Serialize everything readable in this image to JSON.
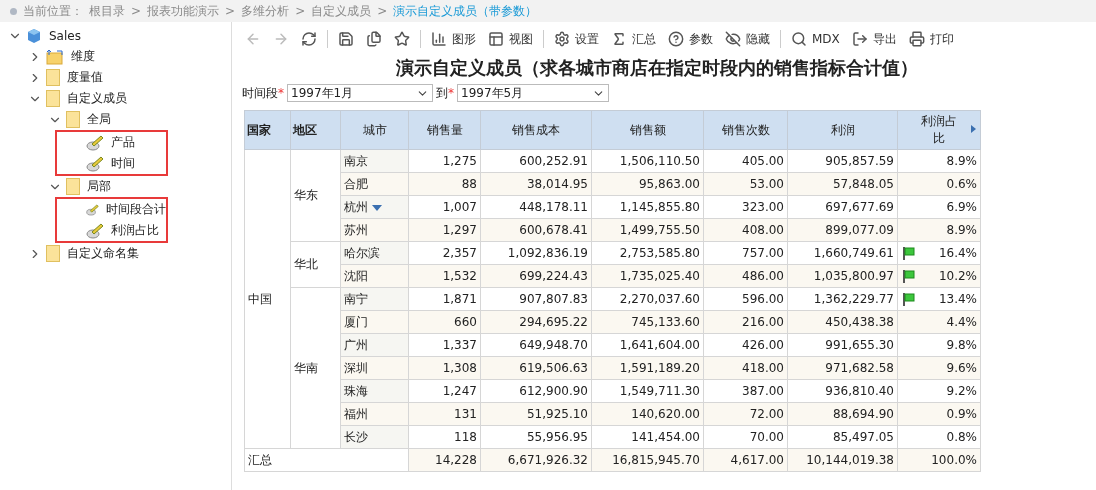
{
  "breadcrumb": {
    "label": "当前位置：",
    "items": [
      {
        "kind": "link",
        "text": "根目录",
        "selected": false
      },
      {
        "kind": "sep",
        "text": ">"
      },
      {
        "kind": "link",
        "text": "报表功能演示",
        "selected": false
      },
      {
        "kind": "sep",
        "text": ">"
      },
      {
        "kind": "link",
        "text": "多维分析",
        "selected": false
      },
      {
        "kind": "sep",
        "text": ">"
      },
      {
        "kind": "link",
        "text": "自定义成员",
        "selected": false
      },
      {
        "kind": "sep",
        "text": ">"
      },
      {
        "kind": "link",
        "text": "演示自定义成员（带参数）",
        "selected": true
      }
    ]
  },
  "tree": {
    "label": "Sales",
    "kind": "cube",
    "expanded": true,
    "children": [
      {
        "label": "维度",
        "kind": "dimension",
        "expanded": false
      },
      {
        "label": "度量值",
        "kind": "folder",
        "expanded": false
      },
      {
        "label": "自定义成员",
        "kind": "folder",
        "expanded": true,
        "children": [
          {
            "label": "全局",
            "kind": "folder",
            "expanded": true,
            "highlighted": true,
            "children": [
              {
                "label": "产品",
                "kind": "member"
              },
              {
                "label": "时间",
                "kind": "member"
              }
            ]
          },
          {
            "label": "局部",
            "kind": "folder",
            "expanded": true,
            "highlighted": true,
            "children": [
              {
                "label": "时间段合计",
                "kind": "member"
              },
              {
                "label": "利润占比",
                "kind": "member"
              }
            ]
          }
        ]
      },
      {
        "label": "自定义命名集",
        "kind": "folder",
        "expanded": false
      }
    ]
  },
  "toolbar": [
    {
      "kind": "button",
      "disabled": true
    },
    {
      "kind": "button",
      "disabled": true
    },
    {
      "kind": "button",
      "disabled": false
    },
    {
      "kind": "sep"
    },
    {
      "kind": "button",
      "disabled": false
    },
    {
      "kind": "button",
      "disabled": false
    },
    {
      "kind": "button",
      "disabled": false
    },
    {
      "kind": "sep"
    },
    {
      "kind": "button",
      "label": "图形",
      "disabled": false
    },
    {
      "kind": "button",
      "label": "视图",
      "disabled": false
    },
    {
      "kind": "sep"
    },
    {
      "kind": "button",
      "label": "设置",
      "disabled": false
    },
    {
      "kind": "button",
      "label": "汇总",
      "disabled": false
    },
    {
      "kind": "button",
      "label": "参数",
      "disabled": false
    },
    {
      "kind": "button",
      "label": "隐藏",
      "disabled": false
    },
    {
      "kind": "sep"
    },
    {
      "kind": "button",
      "label": "MDX",
      "disabled": false
    },
    {
      "kind": "button",
      "label": "导出",
      "disabled": false
    },
    {
      "kind": "button",
      "label": "打印",
      "disabled": false
    }
  ],
  "title": "演示自定义成员（求各城市商店在指定时段内的销售指标合计值）",
  "params": [
    {
      "label": "时间段",
      "mark": "*",
      "value": "1997年1月"
    },
    {
      "label": "到",
      "mark": "*",
      "value": "1997年5月"
    }
  ],
  "table": {
    "columns": [
      "国家",
      "地区",
      "城市",
      "销售量",
      "销售成本",
      "销售额",
      "销售次数",
      "利润",
      "利润占比"
    ],
    "country": "中国",
    "regions": [
      {
        "name": "华东",
        "cities": [
          {
            "name": "南京",
            "flag": false,
            "menu": false,
            "values": [
              "1,275",
              "600,252.91",
              "1,506,110.50",
              "405.00",
              "905,857.59",
              "8.9%"
            ]
          },
          {
            "name": "合肥",
            "flag": false,
            "menu": false,
            "values": [
              "88",
              "38,014.95",
              "95,863.00",
              "53.00",
              "57,848.05",
              "0.6%"
            ]
          },
          {
            "name": "杭州",
            "flag": false,
            "menu": true,
            "values": [
              "1,007",
              "448,178.11",
              "1,145,855.80",
              "323.00",
              "697,677.69",
              "6.9%"
            ]
          },
          {
            "name": "苏州",
            "flag": false,
            "menu": false,
            "values": [
              "1,297",
              "600,678.41",
              "1,499,755.50",
              "408.00",
              "899,077.09",
              "8.9%"
            ]
          }
        ]
      },
      {
        "name": "华北",
        "cities": [
          {
            "name": "哈尔滨",
            "flag": true,
            "menu": false,
            "values": [
              "2,357",
              "1,092,836.19",
              "2,753,585.80",
              "757.00",
              "1,660,749.61",
              "16.4%"
            ]
          },
          {
            "name": "沈阳",
            "flag": true,
            "menu": false,
            "values": [
              "1,532",
              "699,224.43",
              "1,735,025.40",
              "486.00",
              "1,035,800.97",
              "10.2%"
            ]
          }
        ]
      },
      {
        "name": "华南",
        "cities": [
          {
            "name": "南宁",
            "flag": true,
            "menu": false,
            "values": [
              "1,871",
              "907,807.83",
              "2,270,037.60",
              "596.00",
              "1,362,229.77",
              "13.4%"
            ]
          },
          {
            "name": "厦门",
            "flag": false,
            "menu": false,
            "values": [
              "660",
              "294,695.22",
              "745,133.60",
              "216.00",
              "450,438.38",
              "4.4%"
            ]
          },
          {
            "name": "广州",
            "flag": false,
            "menu": false,
            "values": [
              "1,337",
              "649,948.70",
              "1,641,604.00",
              "426.00",
              "991,655.30",
              "9.8%"
            ]
          },
          {
            "name": "深圳",
            "flag": false,
            "menu": false,
            "values": [
              "1,308",
              "619,506.63",
              "1,591,189.20",
              "418.00",
              "971,682.58",
              "9.6%"
            ]
          },
          {
            "name": "珠海",
            "flag": false,
            "menu": false,
            "values": [
              "1,247",
              "612,900.90",
              "1,549,711.30",
              "387.00",
              "936,810.40",
              "9.2%"
            ]
          },
          {
            "name": "福州",
            "flag": false,
            "menu": false,
            "values": [
              "131",
              "51,925.10",
              "140,620.00",
              "72.00",
              "88,694.90",
              "0.9%"
            ]
          },
          {
            "name": "长沙",
            "flag": false,
            "menu": false,
            "values": [
              "118",
              "55,956.95",
              "141,454.00",
              "70.00",
              "85,497.05",
              "0.8%"
            ]
          }
        ]
      }
    ],
    "total": {
      "label": "汇总",
      "values": [
        "14,228",
        "6,671,926.32",
        "16,815,945.70",
        "4,617.00",
        "10,144,019.38",
        "100.0%"
      ]
    }
  }
}
